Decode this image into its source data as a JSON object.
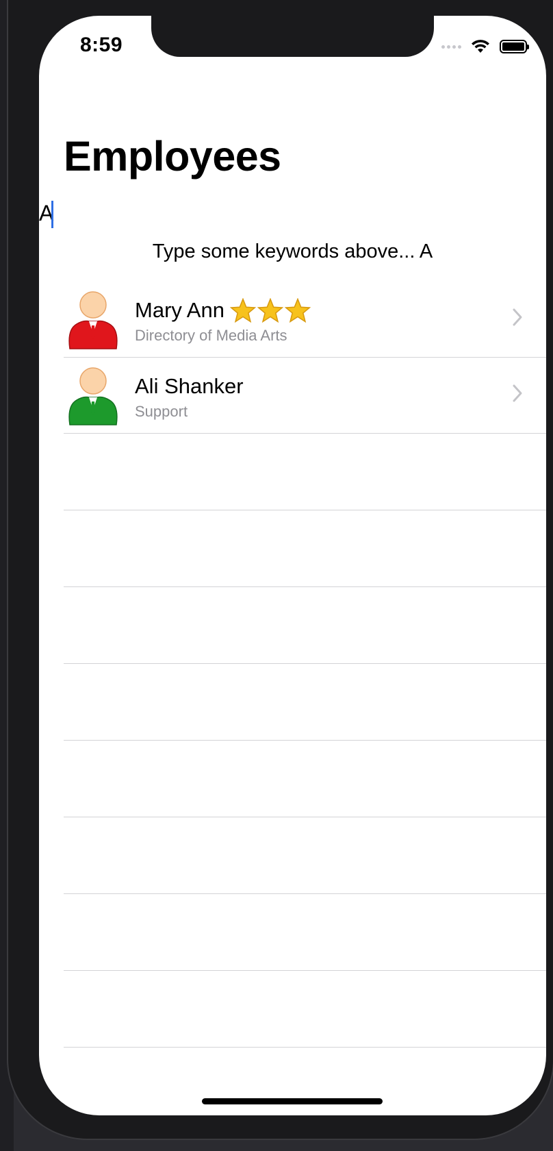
{
  "status_bar": {
    "time": "8:59"
  },
  "page": {
    "title": "Employees"
  },
  "search": {
    "value": "A"
  },
  "hint": {
    "text": "Type some keywords above... A"
  },
  "employees": [
    {
      "name": "Mary Ann",
      "department": "Directory of Media Arts",
      "stars": 3,
      "avatar_color": "#e0161c"
    },
    {
      "name": "Ali Shanker",
      "department": "Support",
      "stars": 0,
      "avatar_color": "#1d9a2c"
    }
  ],
  "colors": {
    "caret": "#2f6fe4",
    "separator": "#d3d3d6",
    "secondary_text": "#8e8e93",
    "star": "#f7c21c"
  }
}
